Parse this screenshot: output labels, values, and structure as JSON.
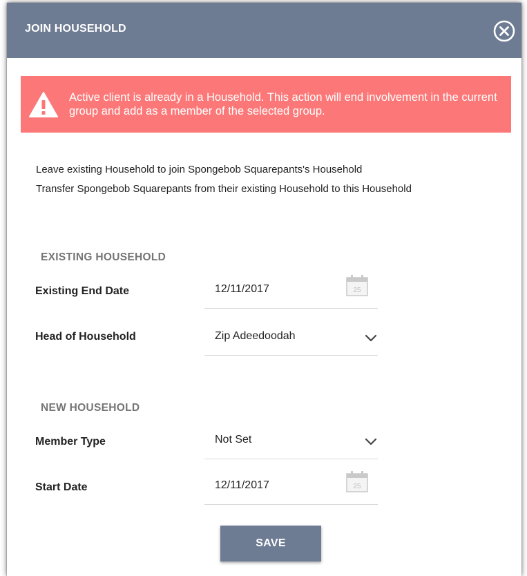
{
  "dialog": {
    "title": "JOIN HOUSEHOLD",
    "close_icon": "close-circle-icon"
  },
  "alert": {
    "icon": "warning-icon",
    "message": "Active client is already in a Household. This action will end involvement in the current group and add as a member of the selected group.",
    "color": "#fc7878"
  },
  "intro": {
    "line1": "Leave existing Household to join Spongebob Squarepants's Household",
    "line2": "Transfer Spongebob Squarepants from their existing Household to this Household"
  },
  "existing": {
    "section_title": "EXISTING HOUSEHOLD",
    "end_date_label": "Existing End Date",
    "end_date_value": "12/11/2017",
    "head_label": "Head of Household",
    "head_value": "Zip Adeedoodah"
  },
  "new": {
    "section_title": "NEW HOUSEHOLD",
    "member_type_label": "Member Type",
    "member_type_value": "Not Set",
    "start_date_label": "Start Date",
    "start_date_value": "12/11/2017"
  },
  "calendar_icon_day": "25",
  "actions": {
    "save_label": "SAVE"
  },
  "colors": {
    "header": "#6d7b93",
    "alert": "#fc7878",
    "button": "#6d7b93"
  }
}
